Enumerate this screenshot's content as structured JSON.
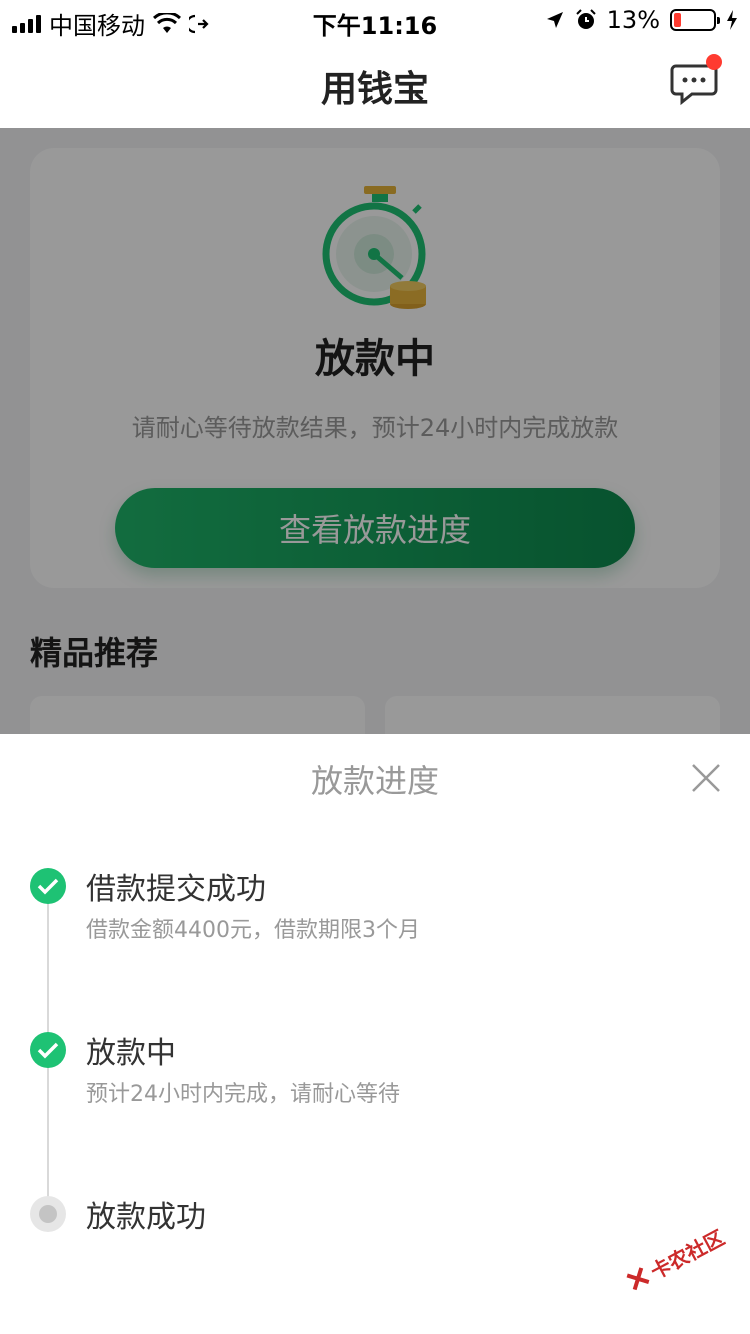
{
  "status_bar": {
    "carrier": "中国移动",
    "time": "下午11:16",
    "battery": "13%",
    "battery_level": 0.13
  },
  "header": {
    "title": "用钱宝",
    "message_icon": "chat-bubble-icon",
    "has_unread": true
  },
  "status_card": {
    "title": "放款中",
    "subtitle": "请耐心等待放款结果，预计24小时内完成放款",
    "button_label": "查看放款进度",
    "illustration": "stopwatch-coins-icon"
  },
  "recommend": {
    "title": "精品推荐"
  },
  "progress_sheet": {
    "title": "放款进度",
    "close_icon": "close-icon",
    "steps": [
      {
        "title": "借款提交成功",
        "desc": "借款金额4400元，借款期限3个月",
        "status": "done"
      },
      {
        "title": "放款中",
        "desc": "预计24小时内完成，请耐心等待",
        "status": "done"
      },
      {
        "title": "放款成功",
        "desc": "",
        "status": "pending"
      }
    ]
  },
  "watermark": {
    "text": "卡农社区"
  },
  "colors": {
    "accent_green": "#1ec274",
    "button_green_start": "#1fb56a",
    "button_green_end": "#0d8a4e",
    "badge_red": "#ff3b30",
    "muted_text": "#999999"
  }
}
